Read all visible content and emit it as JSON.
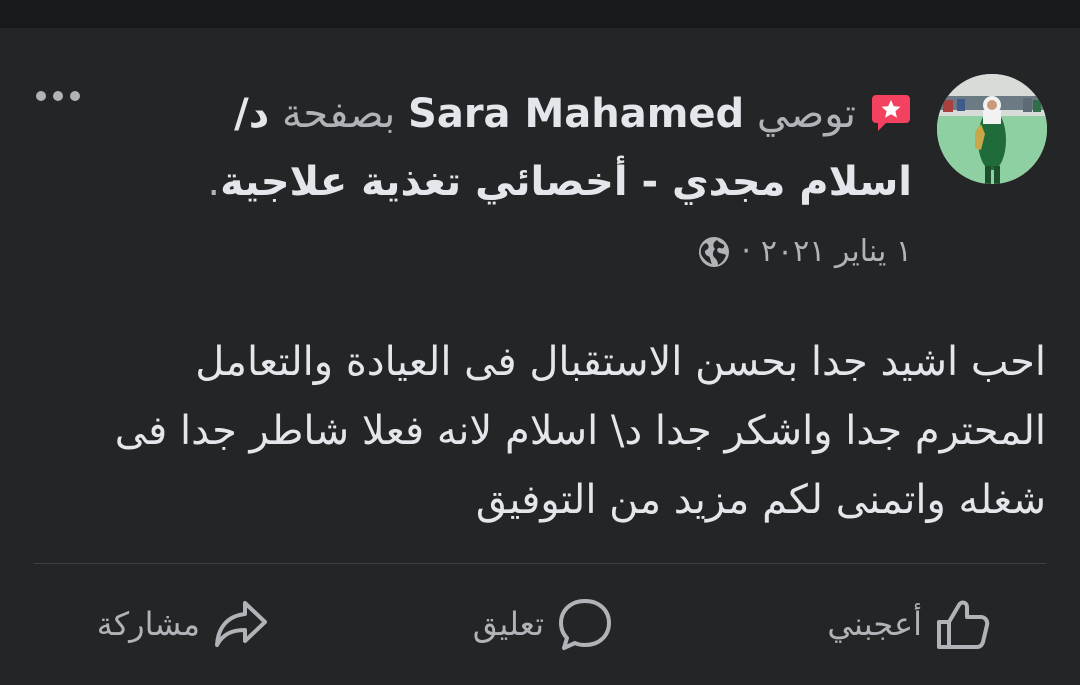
{
  "post": {
    "recommend_verb": "توصي",
    "author_name": "Sara Mahamed",
    "page_prefix": "بصفحة",
    "page_name": "د/ اسلام مجدي - أخصائي تغذية علاجية",
    "period": ".",
    "date": "١ يناير ٢٠٢١",
    "separator": "·",
    "privacy_icon": "globe-icon",
    "body": "احب اشيد جدا بحسن الاستقبال فى العيادة والتعامل المحترم جدا واشكر جدا د\\ اسلام لانه فعلا شاطر جدا فى شغله واتمنى لكم مزيد من التوفيق"
  },
  "actions": {
    "like_label": "أعجبني",
    "comment_label": "تعليق",
    "share_label": "مشاركة"
  },
  "colors": {
    "background": "#18191a",
    "card": "#242526",
    "primary_text": "#e4e6eb",
    "secondary_text": "#b0b3b8",
    "recommend_badge": "#f3425f"
  }
}
